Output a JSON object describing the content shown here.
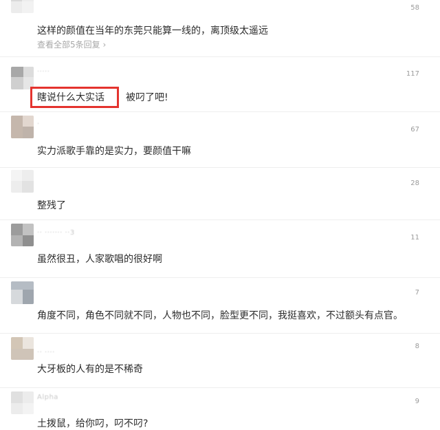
{
  "comments": [
    {
      "likes": "58",
      "text": "这样的颜值在当年的东莞只能算一线的，离顶级太遥远",
      "view_replies": "查看全部5条回复 ›"
    },
    {
      "likes": "117",
      "highlighted": "瞎说什么大实话",
      "text": "被叼了吧!"
    },
    {
      "likes": "67",
      "text": "实力派歌手靠的是实力，要颜值干嘛"
    },
    {
      "likes": "28",
      "text": "整残了"
    },
    {
      "likes": "11",
      "text": "虽然很丑，人家歌唱的很好啊"
    },
    {
      "likes": "7",
      "text": "角度不同，角色不同就不同，人物也不同，脸型更不同，我挺喜欢，不过额头有点官。"
    },
    {
      "likes": "8",
      "text": "大牙板的人有的是不稀奇"
    },
    {
      "username": "Alpha",
      "likes": "9",
      "text": "土拨鼠，给你叼，叼不叼?"
    }
  ],
  "colors": {
    "highlight_border": "#e4332e",
    "divider": "#eeeeee",
    "meta_text": "#9a9a9a"
  }
}
